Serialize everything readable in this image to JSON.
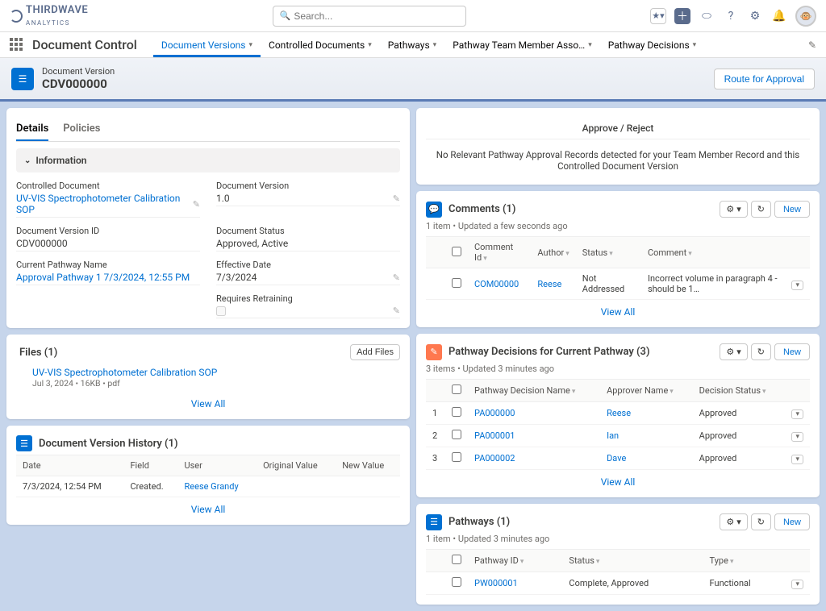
{
  "brand": "THIRDWAVE",
  "brand_sub": "ANALYTICS",
  "search_placeholder": "Search...",
  "app_title": "Document Control",
  "nav": {
    "items": [
      {
        "label": "Document Versions",
        "active": true
      },
      {
        "label": "Controlled Documents"
      },
      {
        "label": "Pathways"
      },
      {
        "label": "Pathway Team Member Asso…"
      },
      {
        "label": "Pathway Decisions"
      }
    ]
  },
  "record": {
    "type_label": "Document Version",
    "title": "CDV000000",
    "route_btn": "Route for Approval"
  },
  "detail_tabs": {
    "details": "Details",
    "policies": "Policies"
  },
  "info": {
    "section_title": "Information",
    "fields": {
      "controlled_doc_label": "Controlled Document",
      "controlled_doc_value": "UV-VIS Spectrophotometer Calibration SOP",
      "doc_version_label": "Document Version",
      "doc_version_value": "1.0",
      "doc_version_id_label": "Document Version ID",
      "doc_version_id_value": "CDV000000",
      "doc_status_label": "Document Status",
      "doc_status_value": "Approved, Active",
      "pathway_name_label": "Current Pathway Name",
      "pathway_name_value": "Approval Pathway 1 7/3/2024, 12:55 PM",
      "effective_date_label": "Effective Date",
      "effective_date_value": "7/3/2024",
      "retrain_label": "Requires Retraining"
    }
  },
  "files": {
    "title": "Files (1)",
    "add_btn": "Add Files",
    "item_name": "UV-VIS Spectrophotometer Calibration SOP",
    "item_meta": "Jul 3, 2024 • 16KB • pdf",
    "view_all": "View All"
  },
  "history": {
    "title": "Document Version History (1)",
    "cols": {
      "date": "Date",
      "field": "Field",
      "user": "User",
      "orig": "Original Value",
      "new": "New Value"
    },
    "row": {
      "date": "7/3/2024, 12:54 PM",
      "field": "Created.",
      "user": "Reese Grandy"
    },
    "view_all": "View All"
  },
  "approve_panel": {
    "title": "Approve / Reject",
    "msg": "No Relevant Pathway Approval Records detected for your Team Member Record and this Controlled Document Version"
  },
  "comments": {
    "title": "Comments (1)",
    "meta": "1 item • Updated a few seconds ago",
    "new_btn": "New",
    "cols": {
      "id": "Comment Id",
      "author": "Author",
      "status": "Status",
      "comment": "Comment"
    },
    "row": {
      "id": "COM00000",
      "author": "Reese",
      "status": "Not Addressed",
      "comment": "Incorrect volume in paragraph 4 - should be 1…"
    },
    "view_all": "View All"
  },
  "decisions": {
    "title": "Pathway Decisions for Current Pathway (3)",
    "meta": "3 items • Updated 3 minutes ago",
    "new_btn": "New",
    "cols": {
      "name": "Pathway Decision Name",
      "approver": "Approver Name",
      "status": "Decision Status"
    },
    "rows": [
      {
        "num": "1",
        "name": "PA000000",
        "approver": "Reese",
        "status": "Approved"
      },
      {
        "num": "2",
        "name": "PA000001",
        "approver": "Ian",
        "status": "Approved"
      },
      {
        "num": "3",
        "name": "PA000002",
        "approver": "Dave",
        "status": "Approved"
      }
    ],
    "view_all": "View All"
  },
  "pathways": {
    "title": "Pathways (1)",
    "meta": "1 item • Updated 3 minutes ago",
    "new_btn": "New",
    "cols": {
      "id": "Pathway ID",
      "status": "Status",
      "type": "Type"
    },
    "row": {
      "id": "PW000001",
      "status": "Complete, Approved",
      "type": "Functional"
    }
  }
}
